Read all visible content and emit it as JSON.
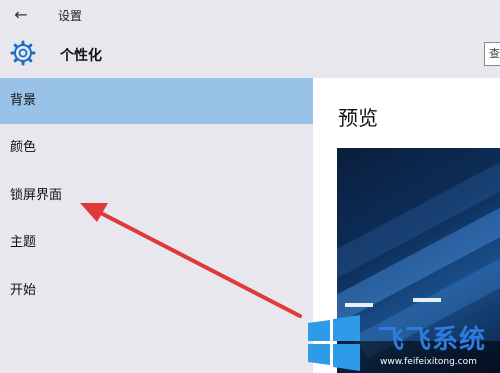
{
  "window": {
    "title": "设置"
  },
  "header": {
    "title": "个性化",
    "search_label": "查"
  },
  "sidebar": {
    "items": [
      {
        "label": "背景",
        "active": true
      },
      {
        "label": "颜色",
        "active": false
      },
      {
        "label": "锁屏界面",
        "active": false
      },
      {
        "label": "主题",
        "active": false
      },
      {
        "label": "开始",
        "active": false
      }
    ]
  },
  "content": {
    "preview_title": "预览"
  },
  "watermark": {
    "text": "飞飞系统",
    "url": "www.feifeixitong.com"
  },
  "colors": {
    "active_item": "#99c2e8",
    "sidebar_bg": "#e9e7ee",
    "arrow": "#e0393a",
    "watermark": "#2e7ce0"
  }
}
